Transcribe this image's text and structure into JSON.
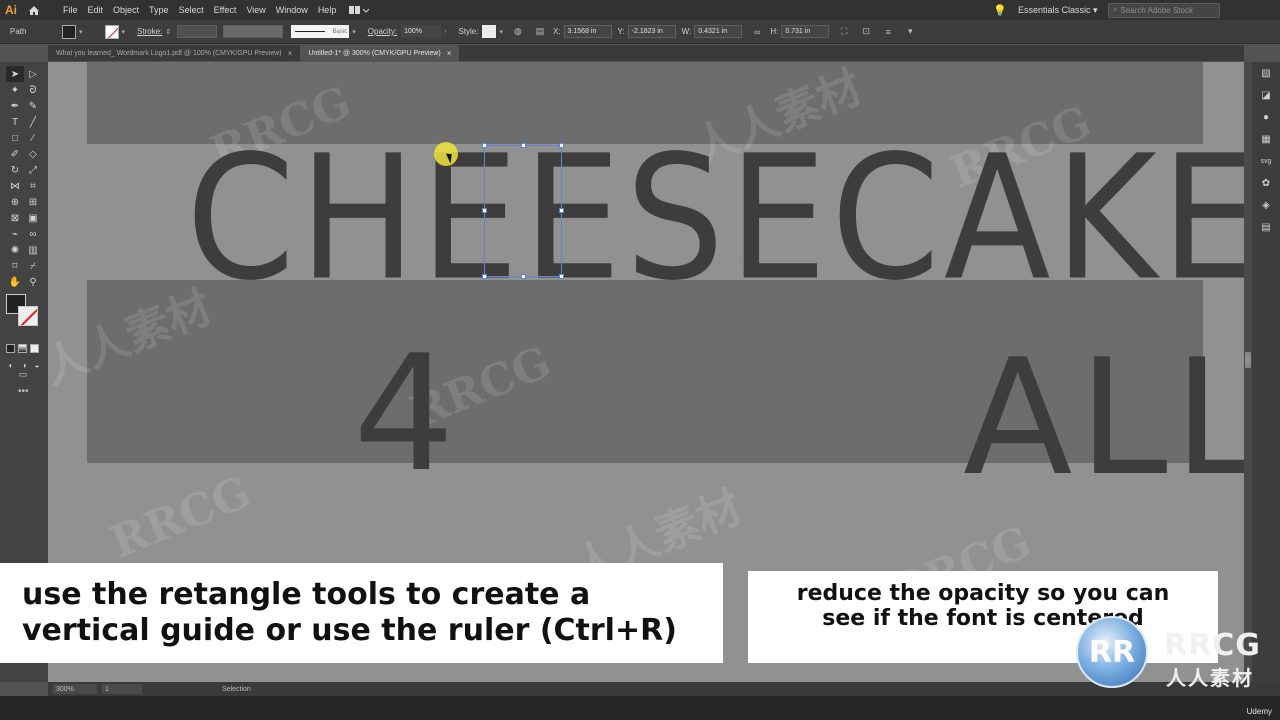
{
  "app": {
    "logo": "Ai",
    "menus": [
      "File",
      "Edit",
      "Object",
      "Type",
      "Select",
      "Effect",
      "View",
      "Window",
      "Help"
    ],
    "workspace": "Essentials Classic",
    "search_placeholder": "Search Adobe Stock"
  },
  "control_bar": {
    "selection_type": "Path",
    "stroke_label": "Stroke:",
    "stroke_profile": "Basic",
    "opacity_label": "Opacity:",
    "opacity_value": "100%",
    "style_label": "Style:",
    "x_label": "X:",
    "x_value": "3.1568 in",
    "y_label": "Y:",
    "y_value": "-2.1823 in",
    "w_label": "W:",
    "w_value": "0.4321 in",
    "h_label": "H:",
    "h_value": "0.731 in"
  },
  "tabs": [
    {
      "label": "What you learned_ Wordmark Logo1.pdf @ 100% (CMYK/GPU Preview)",
      "active": false
    },
    {
      "label": "Untitled-1* @ 300% (CMYK/GPU Preview)",
      "active": true
    }
  ],
  "canvas": {
    "word_main": "CHEESECAKE",
    "word_four": "4",
    "word_all": "ALL",
    "watermarks": [
      "RRCG",
      "人人素材",
      "RRCG",
      "人人素材",
      "RRCG",
      "RRCG",
      "人人素材",
      "RRCG"
    ]
  },
  "status_bar": {
    "zoom": "300%",
    "artboard": "1",
    "tool": "Selection"
  },
  "captions": {
    "left_line1": "use the retangle tools to create a",
    "left_line2": "vertical guide or use the ruler (Ctrl+R)",
    "right_line1": "reduce the opacity so you can",
    "right_line2": "see if the font is centered"
  },
  "branding": {
    "logo_en": "RRCG",
    "logo_cn": "人人素材",
    "udemy": "Udemy"
  }
}
